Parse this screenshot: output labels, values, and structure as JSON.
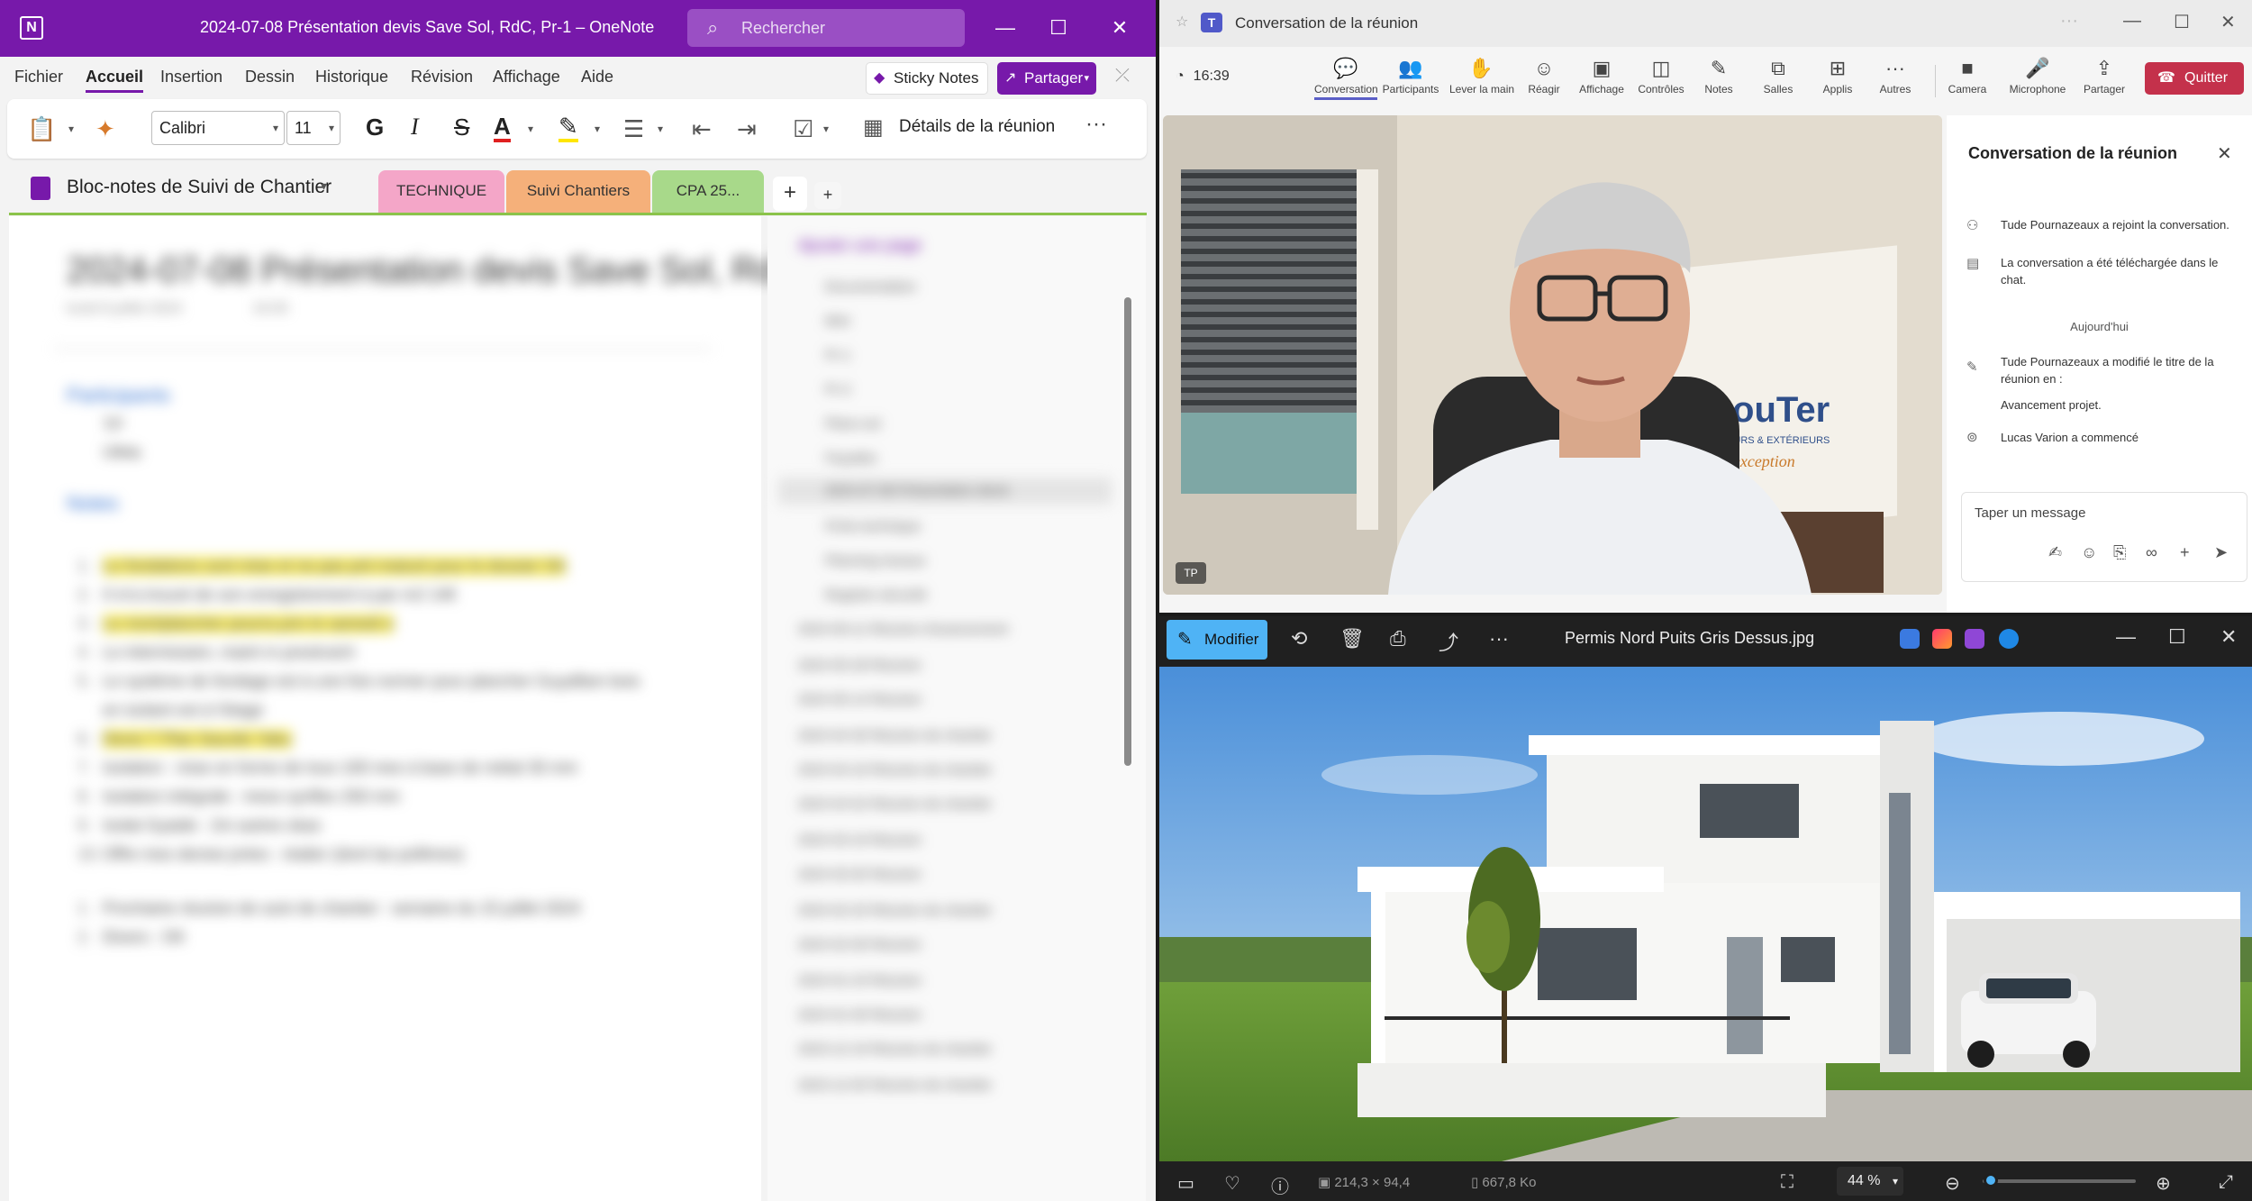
{
  "onenote": {
    "window_title": "2024-07-08 Présentation devis Save Sol, RdC, Pr-1 – OneNote",
    "search_placeholder": "Rechercher",
    "menu": [
      "Fichier",
      "Accueil",
      "Insertion",
      "Dessin",
      "Historique",
      "Révision",
      "Affichage",
      "Aide"
    ],
    "sticky_notes": "Sticky Notes",
    "share": "Partager",
    "font_name": "Calibri",
    "font_size": "11",
    "bold": "G",
    "italic": "I",
    "strike": "S",
    "meeting_details": "Détails de la réunion",
    "notebook_title": "Bloc-notes de Suivi de Chantier",
    "sections": [
      {
        "label": "TECHNIQUE",
        "color": "#f4a6c8"
      },
      {
        "label": "Suivi Chantiers",
        "color": "#f5b07a"
      },
      {
        "label": "CPA 25...",
        "color": "#a8d98a"
      }
    ],
    "page": {
      "title": "2024-07-08 Présentation devis Save Sol, RdC, Pr-1",
      "date": "lundi 8 juillet 2024",
      "time": "16:05",
      "heading_participants": "Participants",
      "participants": [
        "TP",
        "Ufela"
      ],
      "heading_notes": "Notes",
      "lines": [
        "Le fondations sont mise et ne pas pré-maturé pour le dossier SA",
        "Il m'a trouvé de son enregistrement à par m2 14€",
        "Le mort/plancher pourra prix le samedi e",
        "Le intermissien, maint m prestrutch",
        "Le système de fondage est à une fois normer pour plancher Guyaflam bois",
        "en isolant est à l'étage",
        "Devis T Plan Sauvile Yaku",
        "Isolation : mise en forme de tous 100 mes à base de métal 30 mm",
        "Isolation intégrale : mess synflex 250 mm",
        "Isolat Gyaide : 2m autres skas",
        "Offre mes devise jortes : réalier (dont las pollimes)",
        "Prochaine réunion de suivi de chantier : semaine du 15 juillet 2024",
        "Divers : OK"
      ]
    },
    "page_list_header": "Ajouter une page",
    "page_list": [
      "Documentation",
      "Mini",
      "Pr-1",
      "Pr-2",
      "Plans ext",
      "Façades",
      "2024-07-08 Présentation devis",
      "Fiche technique",
      "Planning travaux",
      "Registre sécurité",
      "2024-06-11 Réunion d'avancement",
      "2024-05-28 Réunion",
      "2024-05-14 Réunion",
      "2024-04-30 Réunion de chantier",
      "2024-04-16 Réunion de chantier",
      "2024-04-02 Réunion de chantier",
      "2024-03-19 Réunion",
      "2024-03-05 Réunion",
      "2024-02-20 Réunion de chantier",
      "2024-02-06 Réunion",
      "2024-01-23 Réunion",
      "2024-01-09 Réunion",
      "2023-12-19 Réunion de chantier",
      "2023-12-05 Réunion de chantier"
    ]
  },
  "teams": {
    "window_title": "Conversation de la réunion",
    "clock": "16:39",
    "tools": [
      {
        "icon": "chat-icon",
        "glyph": "💬",
        "label": "Conversation"
      },
      {
        "icon": "participants-icon",
        "glyph": "👥",
        "label": "Participants"
      },
      {
        "icon": "raise-hand-icon",
        "glyph": "✋",
        "label": "Lever la main"
      },
      {
        "icon": "react-icon",
        "glyph": "☺",
        "label": "Réagir"
      },
      {
        "icon": "view-icon",
        "glyph": "▣",
        "label": "Affichage"
      },
      {
        "icon": "controls-icon",
        "glyph": "◫",
        "label": "Contrôles"
      },
      {
        "icon": "notes-icon",
        "glyph": "✎",
        "label": "Notes"
      },
      {
        "icon": "rooms-icon",
        "glyph": "⧉",
        "label": "Salles"
      },
      {
        "icon": "apps-icon",
        "glyph": "⊞",
        "label": "Applis"
      },
      {
        "icon": "more-icon",
        "glyph": "···",
        "label": "Autres"
      }
    ],
    "media": [
      {
        "icon": "camera-icon",
        "glyph": "■",
        "label": "Camera"
      },
      {
        "icon": "microphone-icon",
        "glyph": "🎤",
        "label": "Microphone"
      },
      {
        "icon": "share-screen-icon",
        "glyph": "⇪",
        "label": "Partager"
      }
    ],
    "quit": "Quitter",
    "video": {
      "initials": "TP",
      "brand": "TraouTer",
      "brand_sub": "INTÉRIEURS & EXTÉRIEURS",
      "brand_script": "d'exception"
    },
    "chat": {
      "title": "Conversation de la réunion",
      "events": [
        "Tude Pournazeaux a rejoint la conversation.",
        "La conversation a été téléchargée dans le chat."
      ],
      "day": "Aujourd'hui",
      "events_today": [
        "Tude Pournazeaux a modifié le titre de la réunion en :",
        "Avancement projet.",
        "Lucas Varion a commencé"
      ],
      "input_placeholder": "Taper un message"
    }
  },
  "photos": {
    "edit": "Modifier",
    "file_name": "Permis Nord Puits Gris Dessus.jpg",
    "dimensions": "214,3 × 94,4",
    "file_size": "667,8 Ko",
    "zoom": "44 %",
    "zoom_level": 0.05
  }
}
